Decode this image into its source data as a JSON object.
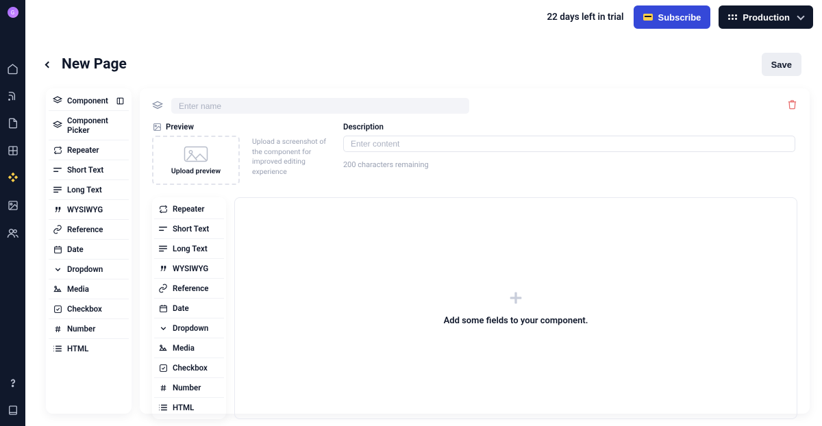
{
  "avatar_initial": "G",
  "topbar": {
    "trial_text": "22 days left in trial",
    "subscribe_label": "Subscribe",
    "production_label": "Production"
  },
  "page": {
    "title": "New Page",
    "save_label": "Save"
  },
  "left_field_types": {
    "header": "Component",
    "items": [
      "Component Picker",
      "Repeater",
      "Short Text",
      "Long Text",
      "WYSIWYG",
      "Reference",
      "Date",
      "Dropdown",
      "Media",
      "Checkbox",
      "Number",
      "HTML"
    ]
  },
  "main_panel": {
    "name_placeholder": "Enter name",
    "preview_label": "Preview",
    "preview_upload_label": "Upload preview",
    "preview_hint": "Upload a screenshot of the component for improved editing experience",
    "description_label": "Description",
    "description_placeholder": "Enter content",
    "char_remaining": "200 characters remaining",
    "drop_hint": "Add some fields to your component."
  },
  "inner_field_types": [
    "Repeater",
    "Short Text",
    "Long Text",
    "WYSIWYG",
    "Reference",
    "Date",
    "Dropdown",
    "Media",
    "Checkbox",
    "Number",
    "HTML"
  ],
  "colors": {
    "accent": "#3548d8",
    "highlight": "#ffd04a",
    "danger": "#e86a6a"
  }
}
